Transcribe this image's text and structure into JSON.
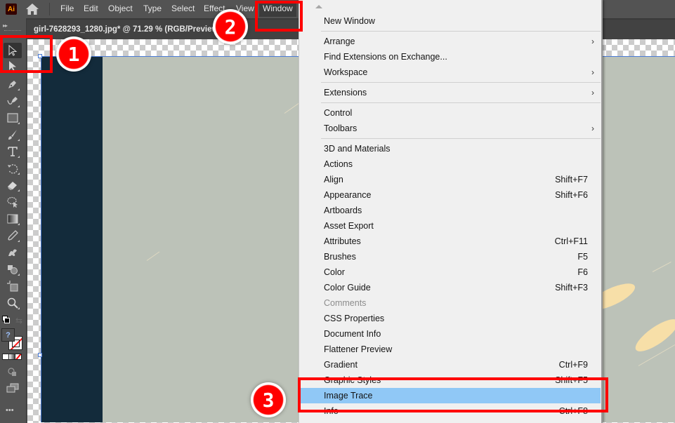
{
  "app": {
    "logo": "Ai",
    "menubar": [
      "File",
      "Edit",
      "Object",
      "Type",
      "Select",
      "Effect",
      "View",
      "Window"
    ],
    "active_menu": "Window"
  },
  "document": {
    "tab_title": "girl-7628293_1280.jpg* @ 71.29 % (RGB/Preview)"
  },
  "toolbar": {
    "tools": [
      {
        "name": "selection-tool",
        "selected": true
      },
      {
        "name": "direct-selection-tool"
      },
      {
        "name": "pen-tool"
      },
      {
        "name": "curvature-tool"
      },
      {
        "name": "rectangle-tool"
      },
      {
        "name": "paintbrush-tool"
      },
      {
        "name": "type-tool"
      },
      {
        "name": "rotate-tool"
      },
      {
        "name": "eraser-tool"
      },
      {
        "name": "lasso-tool"
      },
      {
        "name": "gradient-tool"
      },
      {
        "name": "eyedropper-tool"
      },
      {
        "name": "puppet-warp-tool"
      },
      {
        "name": "shape-builder-tool"
      },
      {
        "name": "artboard-tool"
      },
      {
        "name": "zoom-tool"
      }
    ],
    "fill_label": "?",
    "more_label": "•••"
  },
  "window_menu": {
    "items": [
      {
        "label": "New Window"
      },
      {
        "sep": true
      },
      {
        "label": "Arrange",
        "submenu": true
      },
      {
        "label": "Find Extensions on Exchange..."
      },
      {
        "label": "Workspace",
        "submenu": true
      },
      {
        "sep": true
      },
      {
        "label": "Extensions",
        "submenu": true
      },
      {
        "sep": true
      },
      {
        "label": "Control"
      },
      {
        "label": "Toolbars",
        "submenu": true
      },
      {
        "sep": true
      },
      {
        "label": "3D and Materials"
      },
      {
        "label": "Actions"
      },
      {
        "label": "Align",
        "shortcut": "Shift+F7"
      },
      {
        "label": "Appearance",
        "shortcut": "Shift+F6"
      },
      {
        "label": "Artboards"
      },
      {
        "label": "Asset Export"
      },
      {
        "label": "Attributes",
        "shortcut": "Ctrl+F11"
      },
      {
        "label": "Brushes",
        "shortcut": "F5"
      },
      {
        "label": "Color",
        "shortcut": "F6"
      },
      {
        "label": "Color Guide",
        "shortcut": "Shift+F3"
      },
      {
        "label": "Comments",
        "disabled": true
      },
      {
        "label": "CSS Properties"
      },
      {
        "label": "Document Info"
      },
      {
        "label": "Flattener Preview"
      },
      {
        "label": "Gradient",
        "shortcut": "Ctrl+F9"
      },
      {
        "label": "Graphic Styles",
        "shortcut": "Shift+F5"
      },
      {
        "label": "Image Trace",
        "highlighted": true
      },
      {
        "label": "Info",
        "shortcut": "Ctrl+F8"
      }
    ]
  },
  "annotations": {
    "steps": [
      "1",
      "2",
      "3"
    ],
    "color": "#ff0000"
  },
  "colors": {
    "highlight": "#90c8f6",
    "menu_bg": "#f0f0f0",
    "ui_bg": "#535353"
  }
}
